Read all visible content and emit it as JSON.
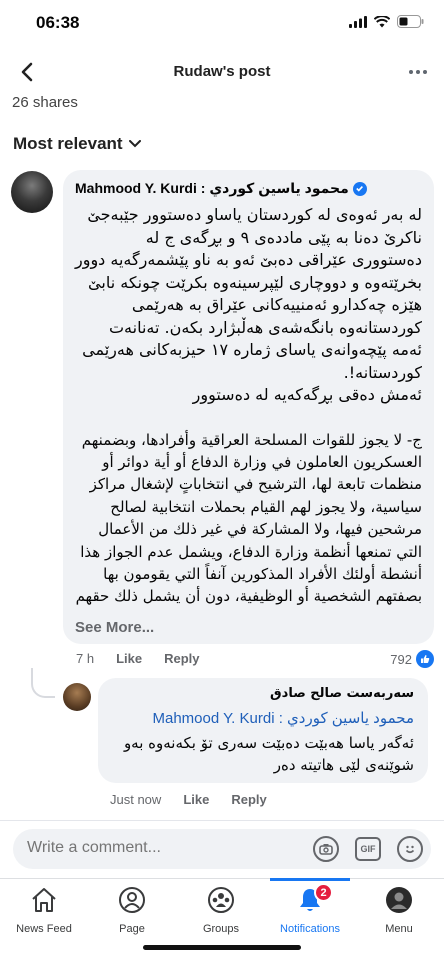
{
  "status": {
    "time": "06:38"
  },
  "header": {
    "title": "Rudaw's post"
  },
  "post": {
    "shares": "26 shares",
    "sort_label": "Most relevant"
  },
  "comment": {
    "author": "Mahmood Y. Kurdi : محمود ياسين كوردي",
    "paragraphs": [
      "له بەر ئەوەی لە کوردستان یاساو دەستوور جێبەجێ ناکرێ دەنا بە پێی ماددەی ٩ و بڕگەی ج لە دەستووری عێراقی دەبێ ئەو بە ناو پێشمەرگەیە دوور بخرێتەوە و دووچاری لێپرسینەوە بکرێت چونکە نابێ هێزە چەکدارو ئەمنییەکانی عێراق بە هەرێمی کوردستانەوە بانگەشەی هەڵبژارد بکەن. تەنانەت ئەمە پێچەوانەی یاسای ژمارە ١٧ حیزبەکانی هەرێمی کوردستانە!.",
      "ئەمش دەقی بڕگەکەیە لە دەستوور",
      "ج- لا يجوز للقوات المسلحة العراقية وأفرادها، وبضمنهم العسكريون العاملون في وزارة الدفاع أو أية دوائر أو منظمات تابعة لها، الترشيح في انتخاباتٍ لإشغال مراكز سياسية، ولا يجوز لهم القيام بحملات انتخابية لصالح مرشحين فيها، ولا المشاركة في غير ذلك من الأعمال التي تمنعها أنظمة وزارة الدفاع، ويشمل عدم الجواز هذا أنشطة أولئك الأفراد المذكورين آنفاً التي يقومون بها بصفتهم الشخصية أو الوظيفية، دون أن يشمل ذلك حقهم"
    ],
    "see_more": "See More...",
    "time": "7 h",
    "like_label": "Like",
    "reply_label": "Reply",
    "reaction_count": "792"
  },
  "reply": {
    "author": "سەربەست صالح صادق",
    "mention": "Mahmood Y. Kurdi : محمود ياسين كوردي",
    "text": "ئەگەر یاسا هەبێت دەبێت سەری تۆ بکەنەوە بەو شوێنەی لێی هاتیتە دەر",
    "time": "Just now",
    "like_label": "Like",
    "reply_label": "Reply"
  },
  "composer": {
    "placeholder": "Write a comment..."
  },
  "tabs": [
    {
      "label": "News Feed",
      "icon": "home-icon"
    },
    {
      "label": "Page",
      "icon": "page-icon"
    },
    {
      "label": "Groups",
      "icon": "groups-icon"
    },
    {
      "label": "Notifications",
      "icon": "bell-icon",
      "badge": "2"
    },
    {
      "label": "Menu",
      "icon": "menu-avatar-icon"
    }
  ],
  "colors": {
    "accent": "#1877f2",
    "bubble": "#f0f2f5",
    "badge": "#e41e3f"
  }
}
